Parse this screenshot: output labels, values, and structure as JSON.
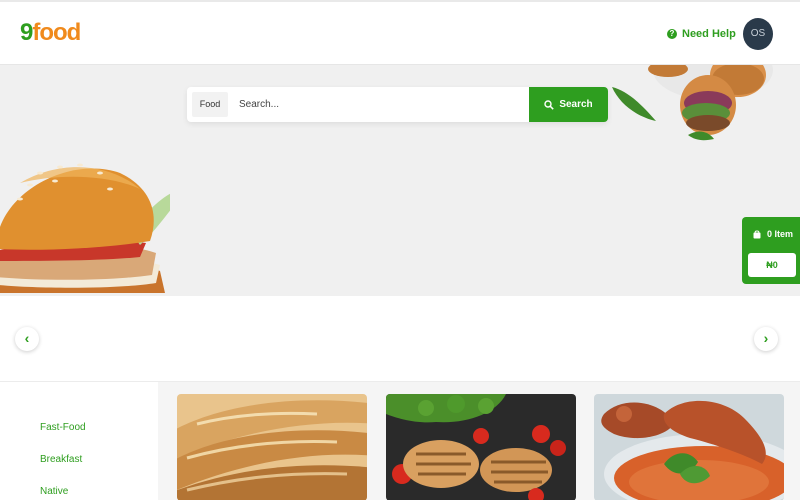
{
  "header": {
    "logo_nine": "9",
    "logo_food": "food",
    "help_icon": "question-circle-icon",
    "help_label": "Need Help",
    "avatar_initials": "OS"
  },
  "search": {
    "category": "Food",
    "placeholder": "Search...",
    "button_label": "Search",
    "button_icon": "search-icon"
  },
  "cart": {
    "icon": "shopping-bag-icon",
    "count_label": "0 Item",
    "total": "₦0"
  },
  "carousel": {
    "prev_icon": "chevron-left-icon",
    "next_icon": "chevron-right-icon",
    "prev_symbol": "‹",
    "next_symbol": "›"
  },
  "categories": {
    "items": [
      {
        "label": "Fast-Food"
      },
      {
        "label": "Breakfast"
      },
      {
        "label": "Native"
      }
    ]
  },
  "food_cards": [
    {
      "image": "bread-loaves"
    },
    {
      "image": "grilled-chicken-tomatoes"
    },
    {
      "image": "jollof-rice-chicken"
    }
  ],
  "colors": {
    "brand_green": "#2e9e1f",
    "brand_orange": "#f08a1c",
    "avatar_bg": "#2a3a4a",
    "hero_bg": "#f0f0f0"
  }
}
